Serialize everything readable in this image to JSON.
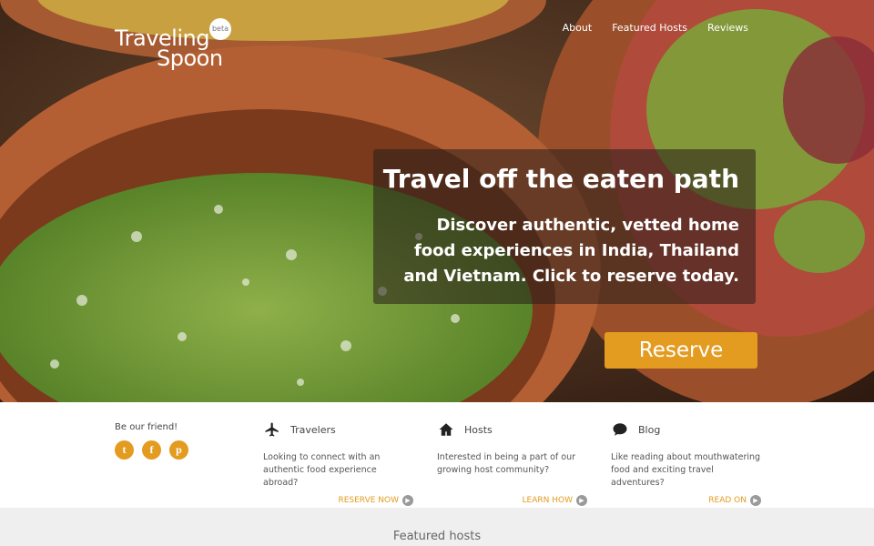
{
  "brand": {
    "name_line1": "Traveling",
    "name_line2": "Spoon",
    "badge": "beta"
  },
  "nav": {
    "items": [
      "About",
      "Featured Hosts",
      "Reviews"
    ]
  },
  "hero": {
    "title": "Travel off the eaten path",
    "text": "Discover authentic, vetted home food experiences in India, Thailand and Vietnam. Click to reserve today.",
    "cta": "Reserve"
  },
  "social": {
    "label": "Be our friend!",
    "icons": [
      "twitter-icon",
      "facebook-icon",
      "pinterest-icon"
    ],
    "glyphs": [
      "t",
      "f",
      "p"
    ]
  },
  "columns": [
    {
      "icon": "airplane-icon",
      "title": "Travelers",
      "desc": "Looking to connect with an authentic food experience abroad?",
      "link": "RESERVE NOW"
    },
    {
      "icon": "house-icon",
      "title": "Hosts",
      "desc": "Interested in being a part of our growing host community?",
      "link": "LEARN HOW"
    },
    {
      "icon": "chat-bubble-icon",
      "title": "Blog",
      "desc": "Like reading about mouthwatering food and exciting travel adventures?",
      "link": "READ ON"
    }
  ],
  "featured": {
    "title": "Featured hosts"
  },
  "colors": {
    "accent": "#e39b20",
    "strip_bg": "#efefef",
    "text": "#444444"
  }
}
